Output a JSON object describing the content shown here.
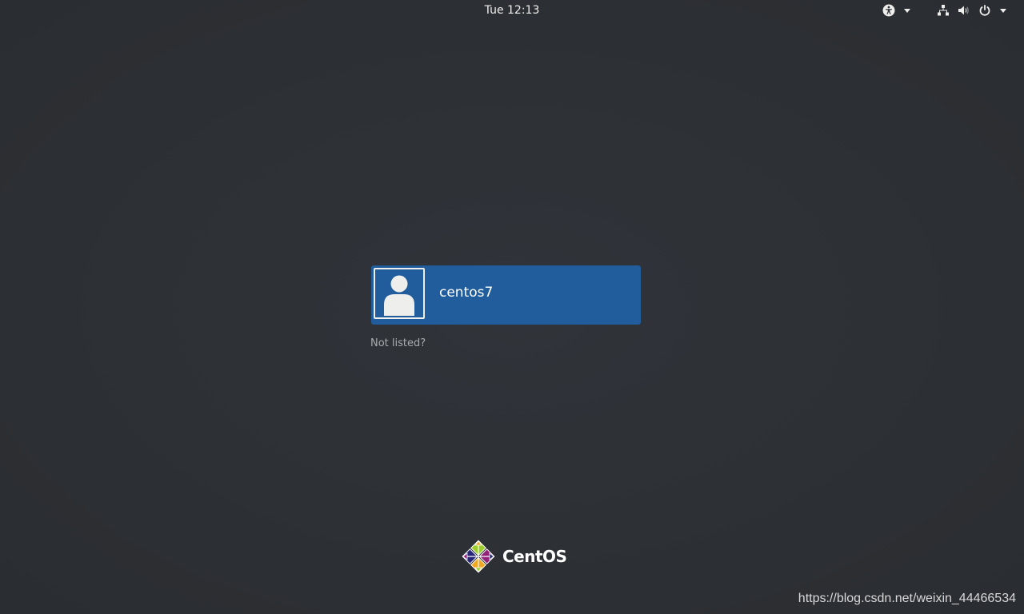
{
  "topbar": {
    "clock": "Tue 12:13",
    "icons": {
      "accessibility": "accessibility-icon",
      "network": "network-wired-icon",
      "volume": "volume-icon",
      "power": "power-icon"
    }
  },
  "login": {
    "users": [
      {
        "name": "centos7",
        "avatar": "default-user-avatar-icon"
      }
    ],
    "not_listed": "Not listed?"
  },
  "branding": {
    "logo_text": "CentOS"
  },
  "watermark": "https://blog.csdn.net/weixin_44466534",
  "colors": {
    "background": "#2e3135",
    "selected_user": "#215d9c",
    "text": "#eeeeec",
    "muted_text": "#a8acae"
  }
}
